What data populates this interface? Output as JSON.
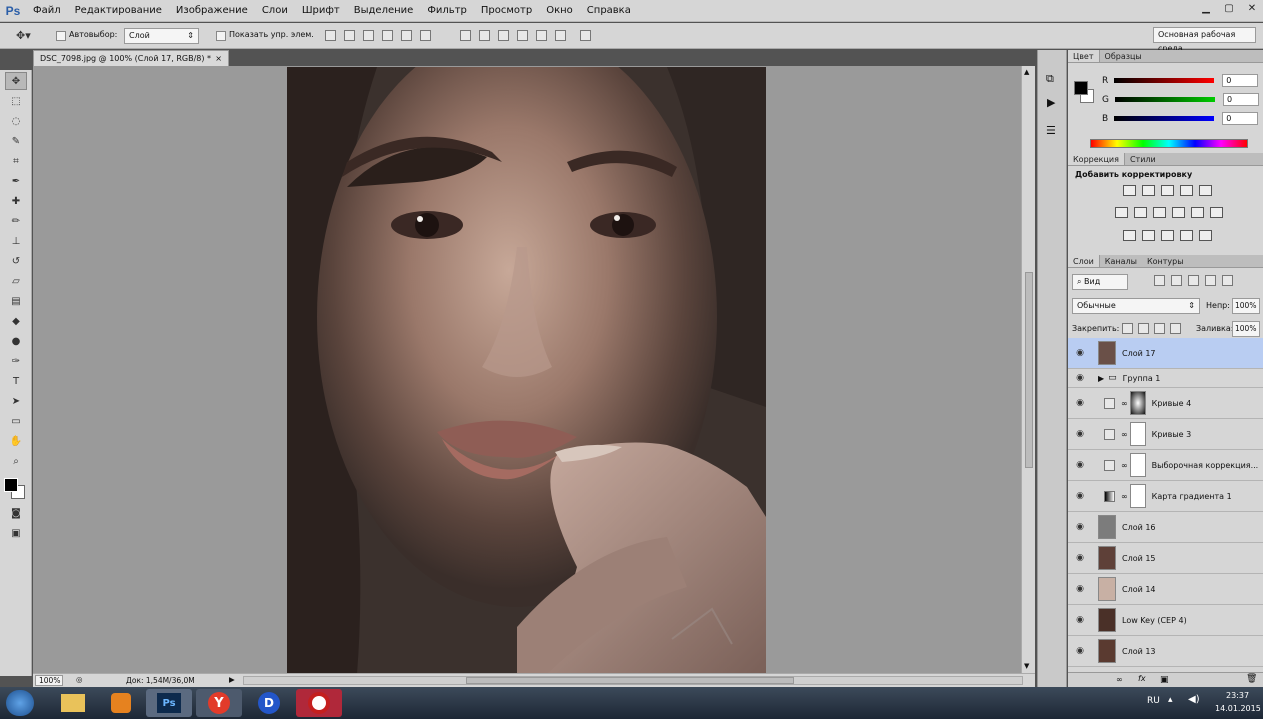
{
  "app": {
    "logo": "Ps"
  },
  "menu": [
    "Файл",
    "Редактирование",
    "Изображение",
    "Слои",
    "Шрифт",
    "Выделение",
    "Фильтр",
    "Просмотр",
    "Окно",
    "Справка"
  ],
  "options": {
    "autoselect_label": "Автовыбор:",
    "autoselect_value": "Слой",
    "show_controls_label": "Показать упр. элем.",
    "workspace": "Основная рабочая среда"
  },
  "document": {
    "tab_title": "DSC_7098.jpg @ 100% (Слой 17, RGB/8) *",
    "zoom": "100%",
    "doc_size": "Док: 1,54M/36,0M"
  },
  "color_panel": {
    "tabs": [
      "Цвет",
      "Образцы"
    ],
    "channels": [
      {
        "label": "R",
        "value": "0"
      },
      {
        "label": "G",
        "value": "0"
      },
      {
        "label": "B",
        "value": "0"
      }
    ]
  },
  "adjust_panel": {
    "tabs": [
      "Коррекция",
      "Стили"
    ],
    "header": "Добавить корректировку"
  },
  "layers_panel": {
    "tabs": [
      "Слои",
      "Каналы",
      "Контуры"
    ],
    "filter": "Вид",
    "blend_mode": "Обычные",
    "opacity_label": "Непр:",
    "opacity": "100%",
    "lock_label": "Закрепить:",
    "fill_label": "Заливка:",
    "fill": "100%",
    "layers": [
      {
        "name": "Слой 17",
        "selected": true
      },
      {
        "name": "Группа 1"
      },
      {
        "name": "Кривые 4"
      },
      {
        "name": "Кривые 3"
      },
      {
        "name": "Выборочная коррекция..."
      },
      {
        "name": "Карта градиента 1"
      },
      {
        "name": "Слой 16"
      },
      {
        "name": "Слой 15"
      },
      {
        "name": "Слой 14"
      },
      {
        "name": "Low Key (СЕР 4)"
      },
      {
        "name": "Слой 13"
      }
    ]
  },
  "taskbar": {
    "lang": "RU",
    "time": "23:37",
    "date": "14.01.2015"
  },
  "colors": {
    "selection": "#b9cdf2",
    "ui_gray": "#d6d6d6",
    "canvas_bg": "#9a9a9a"
  }
}
